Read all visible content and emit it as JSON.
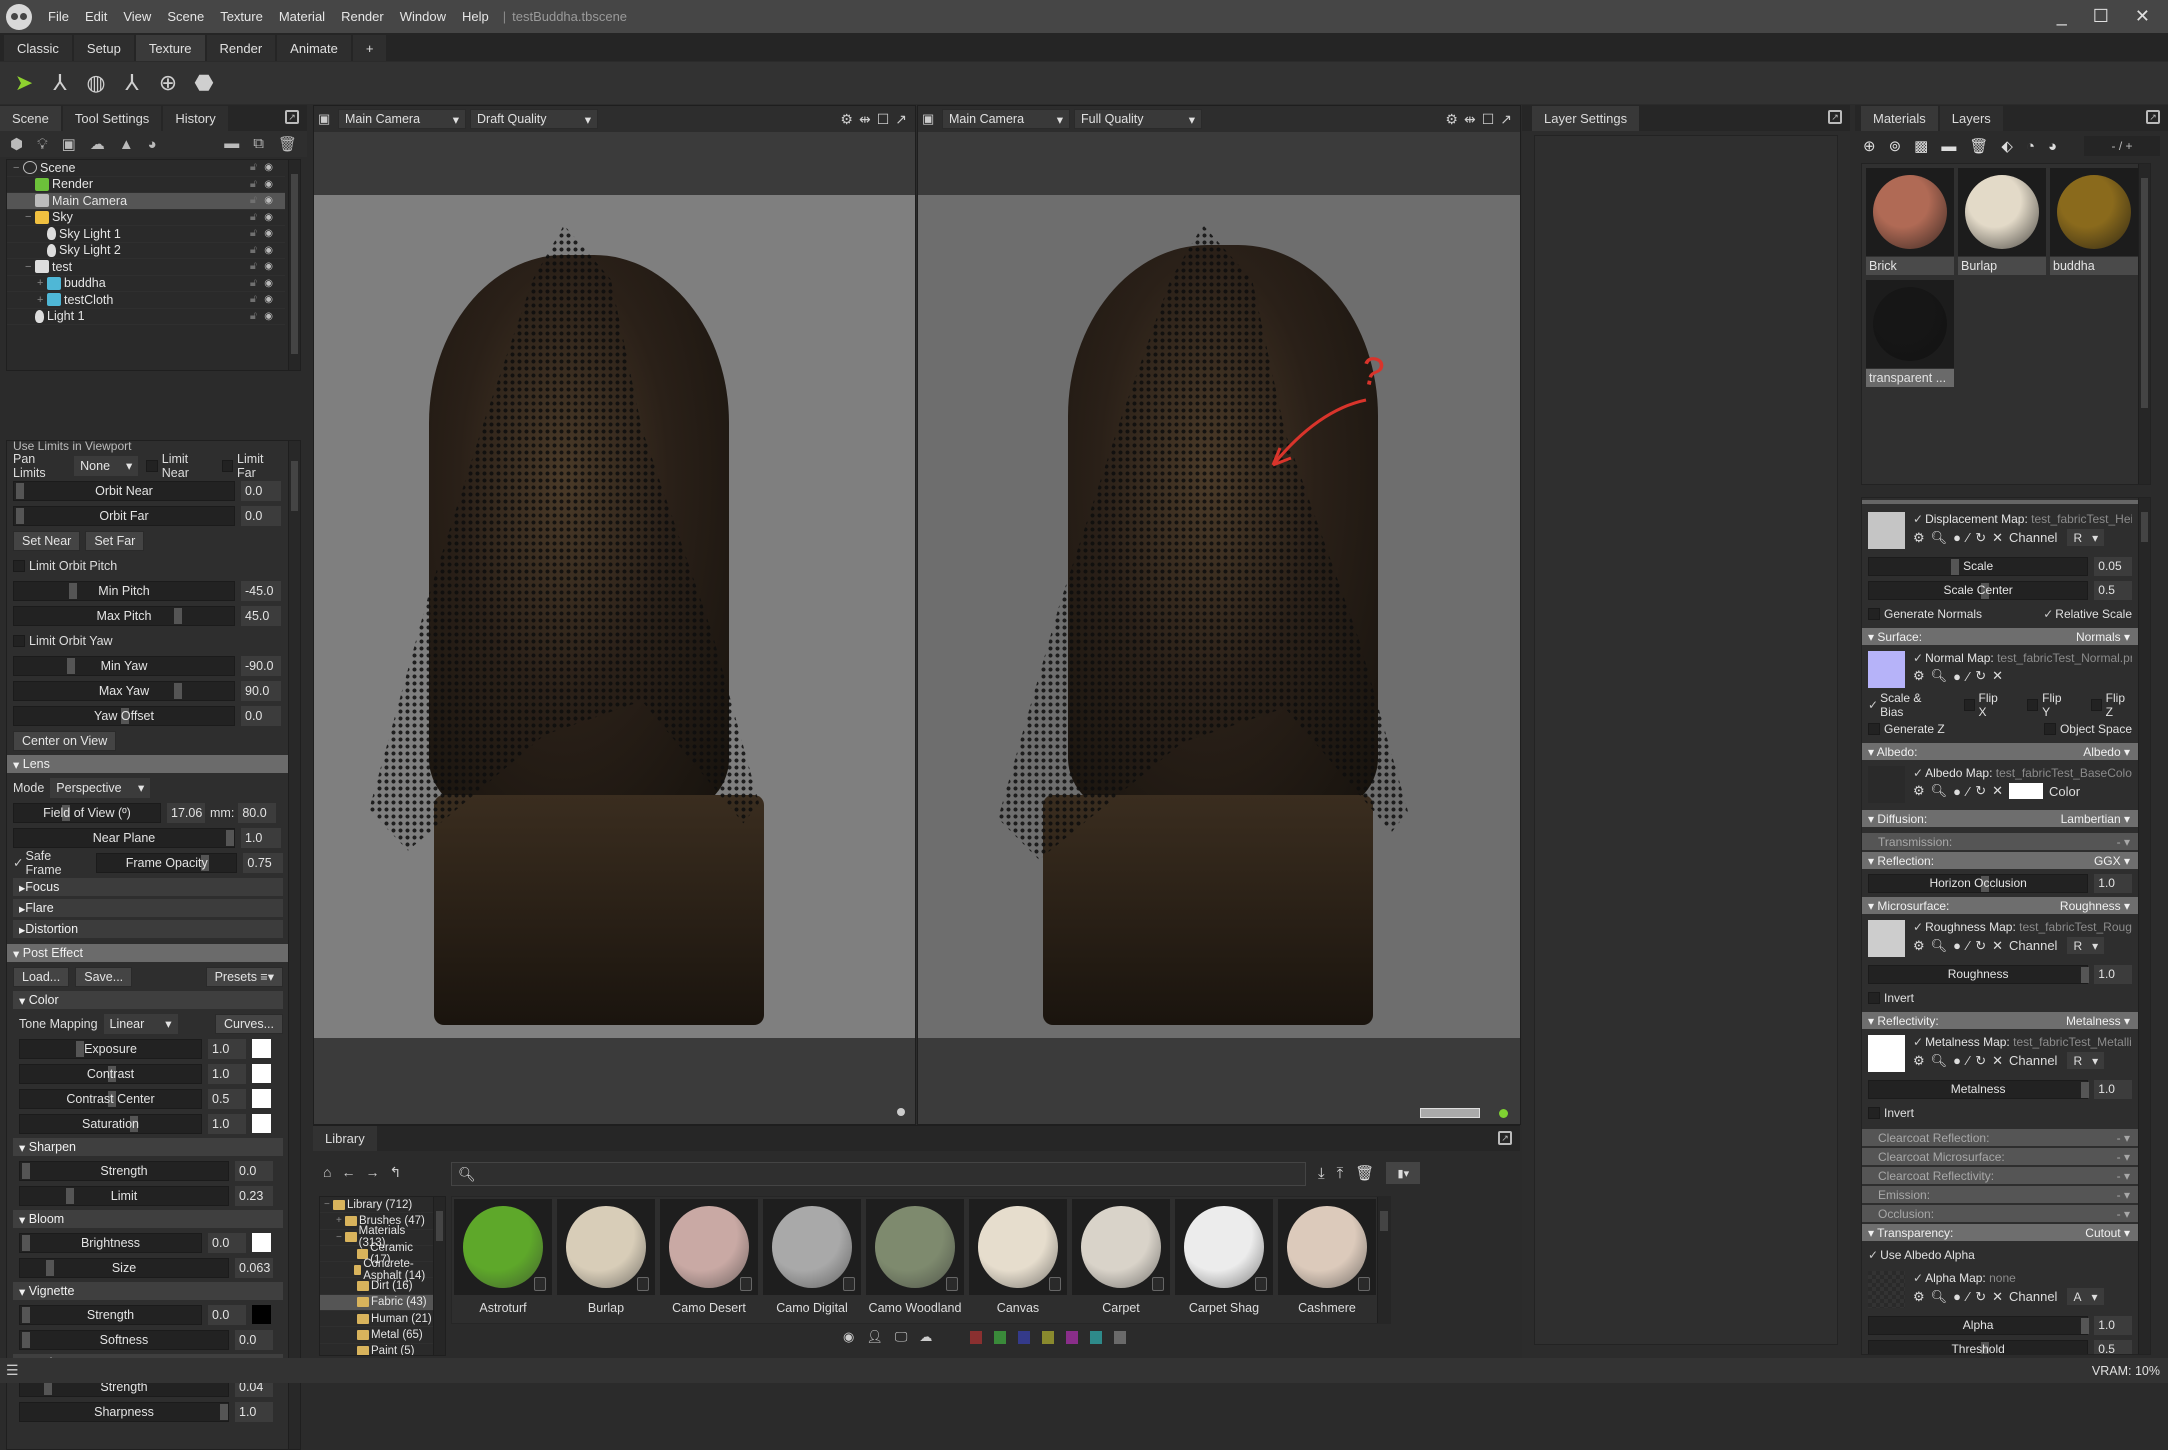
{
  "app": {
    "document_title": "testBuddha.tbscene",
    "menu": [
      "File",
      "Edit",
      "View",
      "Scene",
      "Texture",
      "Material",
      "Render",
      "Window",
      "Help"
    ],
    "window_controls": {
      "minimize": "_",
      "maximize": "☐",
      "close": "✕"
    }
  },
  "workspace_tabs": [
    {
      "label": "Classic",
      "active": false
    },
    {
      "label": "Setup",
      "active": false
    },
    {
      "label": "Texture",
      "active": true
    },
    {
      "label": "Render",
      "active": false
    },
    {
      "label": "Animate",
      "active": false
    },
    {
      "label": "+",
      "active": false
    }
  ],
  "toolbar": {
    "tools": [
      {
        "name": "select-tool",
        "glyph": "➤",
        "active": true
      },
      {
        "name": "move-tool",
        "glyph": "⅄",
        "active": false
      },
      {
        "name": "rotate-tool",
        "glyph": "◍",
        "active": false
      },
      {
        "name": "scale-tool",
        "glyph": "⅄",
        "active": false
      },
      {
        "name": "pivot-tool",
        "glyph": "⊕",
        "active": false
      },
      {
        "name": "mesh-tool",
        "glyph": "⬣",
        "active": false
      }
    ]
  },
  "left_panel": {
    "tabs": [
      "Scene",
      "Tool Settings",
      "History"
    ],
    "active_tab": "Scene",
    "scene_tree": [
      {
        "label": "Scene",
        "depth": 0,
        "icon": "scene",
        "selected": false
      },
      {
        "label": "Render",
        "depth": 1,
        "icon": "render",
        "selected": false
      },
      {
        "label": "Main Camera",
        "depth": 1,
        "icon": "camera",
        "selected": true
      },
      {
        "label": "Sky",
        "depth": 1,
        "icon": "sky",
        "selected": false
      },
      {
        "label": "Sky Light 1",
        "depth": 2,
        "icon": "light",
        "selected": false
      },
      {
        "label": "Sky Light 2",
        "depth": 2,
        "icon": "light",
        "selected": false
      },
      {
        "label": "test",
        "depth": 1,
        "icon": "group",
        "selected": false
      },
      {
        "label": "buddha",
        "depth": 2,
        "icon": "mesh",
        "selected": false
      },
      {
        "label": "testCloth",
        "depth": 2,
        "icon": "mesh",
        "selected": false
      },
      {
        "label": "Light 1",
        "depth": 1,
        "icon": "light",
        "selected": false
      }
    ],
    "camera": {
      "use_limits_label": "Use Limits in Viewport",
      "pan_limits_label": "Pan Limits",
      "pan_limits_value": "None",
      "limit_near_label": "Limit Near",
      "limit_far_label": "Limit Far",
      "orbit_near": {
        "label": "Orbit Near",
        "value": "0.0"
      },
      "orbit_far": {
        "label": "Orbit Far",
        "value": "0.0"
      },
      "set_near_label": "Set Near",
      "set_far_label": "Set Far",
      "limit_orbit_pitch_label": "Limit Orbit Pitch",
      "min_pitch": {
        "label": "Min Pitch",
        "value": "-45.0"
      },
      "max_pitch": {
        "label": "Max Pitch",
        "value": "45.0"
      },
      "limit_orbit_yaw_label": "Limit Orbit Yaw",
      "min_yaw": {
        "label": "Min Yaw",
        "value": "-90.0"
      },
      "max_yaw": {
        "label": "Max Yaw",
        "value": "90.0"
      },
      "yaw_offset": {
        "label": "Yaw Offset",
        "value": "0.0"
      },
      "center_on_view_label": "Center on View"
    },
    "lens": {
      "title": "Lens",
      "mode_label": "Mode",
      "mode_value": "Perspective",
      "fov": {
        "label": "Field of View (º)",
        "value": "17.06",
        "mm_label": "mm:",
        "mm_value": "80.0"
      },
      "near_plane": {
        "label": "Near Plane",
        "value": "1.0"
      },
      "safe_frame_label": "Safe Frame",
      "safe_frame_checked": true,
      "frame_opacity": {
        "label": "Frame Opacity",
        "value": "0.75"
      },
      "subsections": [
        "Focus",
        "Flare",
        "Distortion"
      ]
    },
    "post_effect": {
      "title": "Post Effect",
      "load_label": "Load...",
      "save_label": "Save...",
      "presets_label": "Presets",
      "color": {
        "title": "Color",
        "tone_mapping_label": "Tone Mapping",
        "tone_mapping_value": "Linear",
        "curves_label": "Curves...",
        "exposure": {
          "label": "Exposure",
          "value": "1.0"
        },
        "contrast": {
          "label": "Contrast",
          "value": "1.0"
        },
        "contrast_center": {
          "label": "Contrast Center",
          "value": "0.5"
        },
        "saturation": {
          "label": "Saturation",
          "value": "1.0"
        }
      },
      "sharpen": {
        "title": "Sharpen",
        "strength": {
          "label": "Strength",
          "value": "0.0"
        },
        "limit": {
          "label": "Limit",
          "value": "0.23"
        }
      },
      "bloom": {
        "title": "Bloom",
        "brightness": {
          "label": "Brightness",
          "value": "0.0"
        },
        "size": {
          "label": "Size",
          "value": "0.063"
        }
      },
      "vignette": {
        "title": "Vignette",
        "strength": {
          "label": "Strength",
          "value": "0.0"
        },
        "softness": {
          "label": "Softness",
          "value": "0.0"
        }
      },
      "grain": {
        "title": "Grain",
        "strength": {
          "label": "Strength",
          "value": "0.04"
        },
        "sharpness": {
          "label": "Sharpness",
          "value": "1.0"
        }
      }
    }
  },
  "viewports": [
    {
      "camera": "Main Camera",
      "quality": "Draft Quality"
    },
    {
      "camera": "Main Camera",
      "quality": "Full Quality",
      "annotation": "?"
    }
  ],
  "layer_settings": {
    "title": "Layer Settings"
  },
  "right_panel": {
    "tabs": [
      "Materials",
      "Layers"
    ],
    "active_tab": "Materials",
    "plus_minus_label": "- / +",
    "materials": [
      {
        "name": "Brick",
        "color": "#b06a55",
        "selected": false
      },
      {
        "name": "Burlap",
        "color": "#e3dac8",
        "selected": false
      },
      {
        "name": "buddha",
        "color": "#8a6a1c",
        "selected": false
      },
      {
        "name": "transparent ...",
        "color": "#161616",
        "selected": true
      }
    ],
    "displacement": {
      "map_label": "Displacement Map:",
      "map_file": "test_fabricTest_Height.",
      "channel_label": "Channel",
      "channel_value": "R",
      "scale": {
        "label": "Scale",
        "value": "0.05"
      },
      "scale_center": {
        "label": "Scale Center",
        "value": "0.5"
      },
      "generate_normals_label": "Generate Normals",
      "relative_scale_label": "Relative Scale"
    },
    "surface": {
      "title": "Surface:",
      "mode": "Normals",
      "map_label": "Normal Map:",
      "map_file": "test_fabricTest_Normal.png",
      "scale_bias_label": "Scale & Bias",
      "flip_x_label": "Flip X",
      "flip_y_label": "Flip Y",
      "flip_z_label": "Flip Z",
      "generate_z_label": "Generate Z",
      "object_space_label": "Object Space"
    },
    "albedo": {
      "title": "Albedo:",
      "mode": "Albedo",
      "map_label": "Albedo Map:",
      "map_file": "test_fabricTest_BaseColor.png",
      "color_label": "Color"
    },
    "diffusion": {
      "title": "Diffusion:",
      "mode": "Lambertian"
    },
    "transmission": {
      "title": "Transmission:",
      "mode": "-"
    },
    "reflection": {
      "title": "Reflection:",
      "mode": "GGX",
      "horizon_occlusion": {
        "label": "Horizon Occlusion",
        "value": "1.0"
      }
    },
    "microsurface": {
      "title": "Microsurface:",
      "mode": "Roughness",
      "map_label": "Roughness Map:",
      "map_file": "test_fabricTest_Roughness",
      "channel_label": "Channel",
      "channel_value": "R",
      "roughness": {
        "label": "Roughness",
        "value": "1.0"
      },
      "invert_label": "Invert"
    },
    "reflectivity": {
      "title": "Reflectivity:",
      "mode": "Metalness",
      "map_label": "Metalness Map:",
      "map_file": "test_fabricTest_Metallic.pn",
      "channel_label": "Channel",
      "channel_value": "R",
      "metalness": {
        "label": "Metalness",
        "value": "1.0"
      },
      "invert_label": "Invert"
    },
    "disabled_sections": [
      {
        "title": "Clearcoat Reflection:",
        "mode": "-"
      },
      {
        "title": "Clearcoat Microsurface:",
        "mode": "-"
      },
      {
        "title": "Clearcoat Reflectivity:",
        "mode": "-"
      },
      {
        "title": "Emission:",
        "mode": "-"
      },
      {
        "title": "Occlusion:",
        "mode": "-"
      }
    ],
    "transparency": {
      "title": "Transparency:",
      "mode": "Cutout",
      "use_albedo_alpha_label": "Use Albedo Alpha",
      "map_label": "Alpha Map:",
      "map_file": "none",
      "channel_label": "Channel",
      "channel_value": "A",
      "alpha": {
        "label": "Alpha",
        "value": "1.0"
      },
      "threshold": {
        "label": "Threshold",
        "value": "0.5"
      }
    }
  },
  "library": {
    "tab": "Library",
    "search_placeholder": "",
    "tree": [
      {
        "label": "Library (712)",
        "depth": 0,
        "selected": false
      },
      {
        "label": "Brushes (47)",
        "depth": 1,
        "selected": false
      },
      {
        "label": "Materials (313)",
        "depth": 1,
        "selected": false
      },
      {
        "label": "Ceramic (17)",
        "depth": 2,
        "selected": false
      },
      {
        "label": "Concrete-Asphalt (14)",
        "depth": 2,
        "selected": false
      },
      {
        "label": "Dirt (16)",
        "depth": 2,
        "selected": false
      },
      {
        "label": "Fabric (43)",
        "depth": 2,
        "selected": true
      },
      {
        "label": "Human (21)",
        "depth": 2,
        "selected": false
      },
      {
        "label": "Metal (65)",
        "depth": 2,
        "selected": false
      },
      {
        "label": "Paint (5)",
        "depth": 2,
        "selected": false
      }
    ],
    "items": [
      {
        "name": "Astroturf",
        "color": "#5ea82a"
      },
      {
        "name": "Burlap",
        "color": "#d8cdb8"
      },
      {
        "name": "Camo Desert",
        "color": "#c9a9a4"
      },
      {
        "name": "Camo Digital",
        "color": "#a9a9a9"
      },
      {
        "name": "Camo Woodland",
        "color": "#7e8a6e"
      },
      {
        "name": "Canvas",
        "color": "#e6ddcd"
      },
      {
        "name": "Carpet",
        "color": "#d9d3c9"
      },
      {
        "name": "Carpet Shag",
        "color": "#ececec"
      },
      {
        "name": "Cashmere",
        "color": "#dccabb"
      }
    ],
    "color_filters": [
      "#8a3030",
      "#3a8a3a",
      "#343a8a",
      "#8a8a2e",
      "#8a2e8a",
      "#2e8a8a",
      "#6a6a6a"
    ]
  },
  "status_bar": {
    "vram": "VRAM: 10%"
  }
}
